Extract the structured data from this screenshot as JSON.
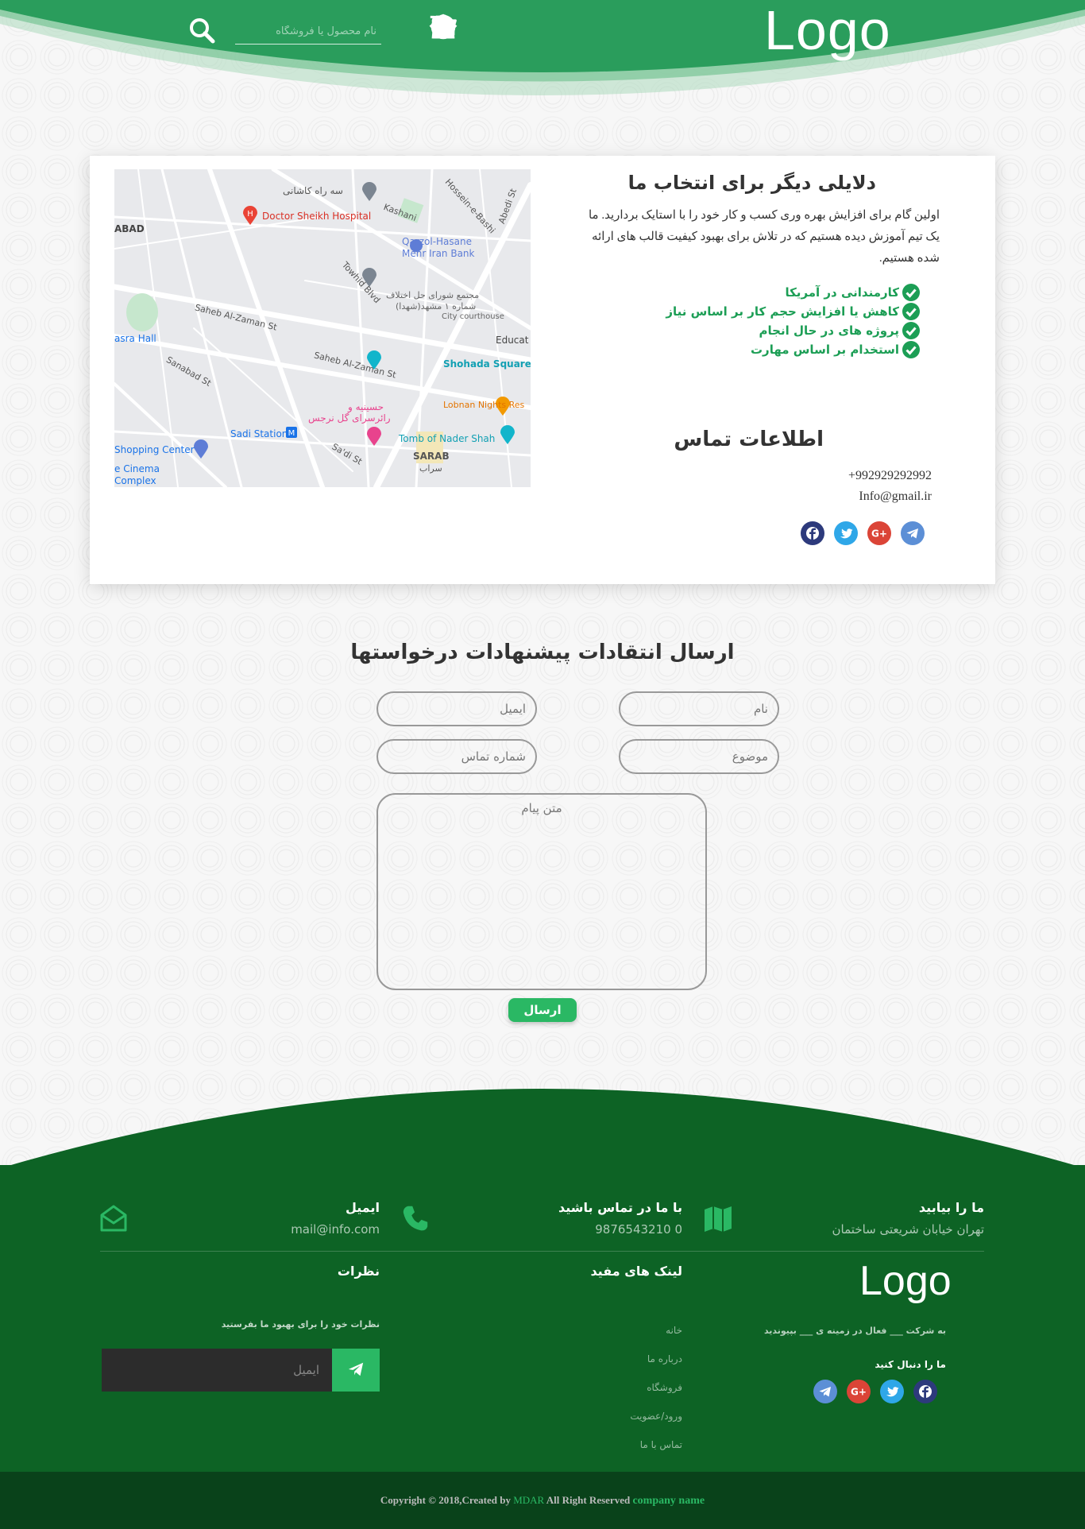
{
  "header": {
    "logo": "Logo",
    "search_placeholder": "نام محصول یا فروشگاه",
    "nav_icons": [
      "home-icon",
      "user-icon",
      "cart-icon",
      "shopping-bag-icon",
      "info-icon",
      "phone-icon"
    ],
    "color": "#2a9d5c"
  },
  "map": {
    "labels": {
      "ferdowsi": "Doctor Sheikh Hospital",
      "qarzol": "Qarzol-Hasane",
      "mehr": "Mehr Iran Bank",
      "shohada": "Shohada Square",
      "lobnan": "Lobnan Nights Res",
      "tomb": "Tomb of Nader Shah",
      "sadi": "Sadi Station",
      "shopping": "Shopping Center",
      "cinema1": "e Cinema",
      "cinema2": "Complex",
      "sarab": "SARAB",
      "sarab_fa": "سراب",
      "hall": "asra Hall",
      "abad": "ABAD",
      "educat": "Educat",
      "seh_rah": "سه راه کاشانی",
      "courthouse_fa1": "مجتمع شورای حل اختلاف",
      "courthouse_fa2": "شماره ۱ مشهد(شهدا)",
      "courthouse": "City courthouse",
      "hosseinieh1": "حسینیه و",
      "hosseinieh2": "رائرسرای گل نرجس",
      "st_saheb1": "Saheb Al-Zaman St",
      "st_saheb2": "Saheb Al-Zaman St",
      "st_towhid": "Towhid Blvd",
      "st_sanabad": "Sanabad St",
      "st_kashani": "Kashani",
      "st_hossein": "Hossein-e-Bashi",
      "st_sadi": "Sa'di St",
      "st_abedi": "Abedi St"
    }
  },
  "why": {
    "title": "دلایلی دیگر برای انتخاب ما",
    "text": "اولین گام برای افزایش بهره وری کسب و کار خود را با استایک بردارید. ما یک تیم آموزش دیده هستیم که در تلاش برای بهبود کیفیت قالب های ارائه شده هستیم.",
    "items": [
      "کارمندانی در آمریکا",
      "کاهش یا افزایش حجم کار بر اساس نیاز",
      "پروژه های در حال انجام",
      "استخدام بر اساس مهارت"
    ],
    "accent": "#1c9e55"
  },
  "contact": {
    "title": "اطلاعات تماس",
    "phone": "+992929292992",
    "email": "Info@gmail.ir",
    "social": [
      "facebook-icon",
      "twitter-icon",
      "google-plus-icon",
      "telegram-icon"
    ]
  },
  "form": {
    "title": "ارسال انتقادات پیشنهادات درخواستها",
    "name_placeholder": "نام",
    "email_placeholder": "ایمیل",
    "subject_placeholder": "موضوع",
    "phone_placeholder": "شماره تماس",
    "message_placeholder": "متن پیام",
    "submit_label": "ارسال"
  },
  "footer": {
    "find_title": "ما را بیابید",
    "find_text": "تهران خیابان شریعتی ساختمان",
    "call_title": "با ما در تماس باشید",
    "call_text": "0 9876543210",
    "email_title": "ایمیل",
    "email_text": "mail@info.com",
    "logo": "Logo",
    "about": "به شرکت ___ فعال در زمینه ی ___ بپیوندید",
    "follow": "ما را دنبال کنید",
    "links_title": "لینک های مفید",
    "links": [
      "خانه",
      "درباره ما",
      "فروشگاه",
      "ورود/عضویت",
      "تماس با ما"
    ],
    "comments_title": "نظرات",
    "comments_text": "نظرات خود را برای بهبود ما بفرستید",
    "newsletter_placeholder": "ایمیل",
    "color": "#0d6325"
  },
  "copyright": {
    "prefix": "Copyright © 2018,Created by",
    "author": "MDAR",
    "middle": "All Right Reserved",
    "company": "company name"
  }
}
